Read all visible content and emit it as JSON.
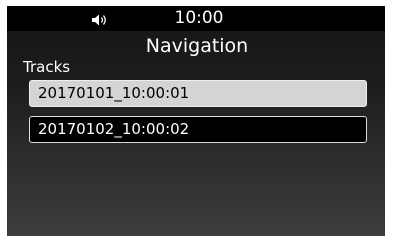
{
  "status_bar": {
    "volume_icon": "speaker-volume-icon",
    "time": "10:00"
  },
  "header": {
    "title": "Navigation"
  },
  "tracks": {
    "label": "Tracks",
    "items": [
      {
        "label": "20170101_10:00:01",
        "selected": true
      },
      {
        "label": "20170102_10:00:02",
        "selected": false
      }
    ]
  },
  "colors": {
    "status_bar_bg": "#000000",
    "selected_item_bg": "#d4d4d4",
    "item_bg": "#000000",
    "item_border": "#dcdcdc",
    "text": "#ffffff"
  }
}
